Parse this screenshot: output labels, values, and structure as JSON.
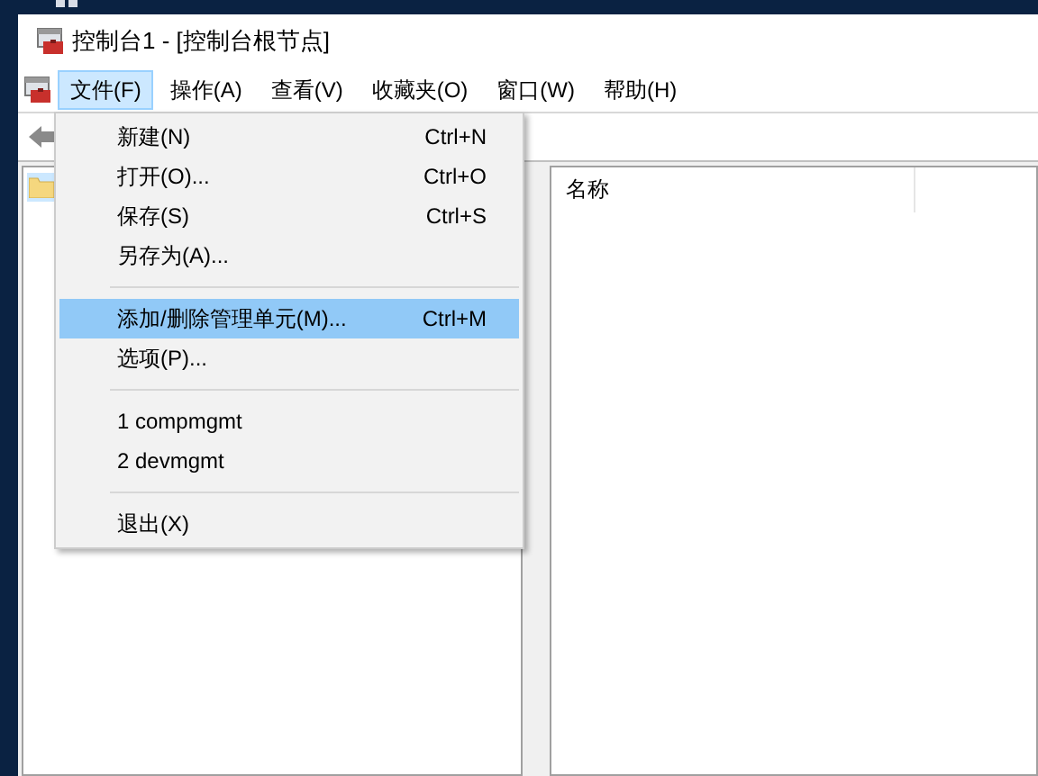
{
  "window": {
    "title": "控制台1 - [控制台根节点]"
  },
  "menu_bar": [
    {
      "label": "文件(F)",
      "selected": true
    },
    {
      "label": "操作(A)",
      "selected": false
    },
    {
      "label": "查看(V)",
      "selected": false
    },
    {
      "label": "收藏夹(O)",
      "selected": false
    },
    {
      "label": "窗口(W)",
      "selected": false
    },
    {
      "label": "帮助(H)",
      "selected": false
    }
  ],
  "file_menu": {
    "items": [
      {
        "kind": "item",
        "label": "新建(N)",
        "shortcut": "Ctrl+N",
        "selected": false
      },
      {
        "kind": "item",
        "label": "打开(O)...",
        "shortcut": "Ctrl+O",
        "selected": false
      },
      {
        "kind": "item",
        "label": "保存(S)",
        "shortcut": "Ctrl+S",
        "selected": false
      },
      {
        "kind": "item",
        "label": "另存为(A)...",
        "selected": false
      },
      {
        "kind": "separator"
      },
      {
        "kind": "item",
        "label": "添加/删除管理单元(M)...",
        "shortcut": "Ctrl+M",
        "selected": true
      },
      {
        "kind": "item",
        "label": "选项(P)...",
        "selected": false
      },
      {
        "kind": "separator"
      },
      {
        "kind": "item",
        "label": "1 compmgmt",
        "selected": false
      },
      {
        "kind": "item",
        "label": "2 devmgmt",
        "selected": false
      },
      {
        "kind": "separator"
      },
      {
        "kind": "item",
        "label": "退出(X)",
        "selected": false
      }
    ]
  },
  "result_pane": {
    "columns": [
      "名称"
    ]
  }
}
